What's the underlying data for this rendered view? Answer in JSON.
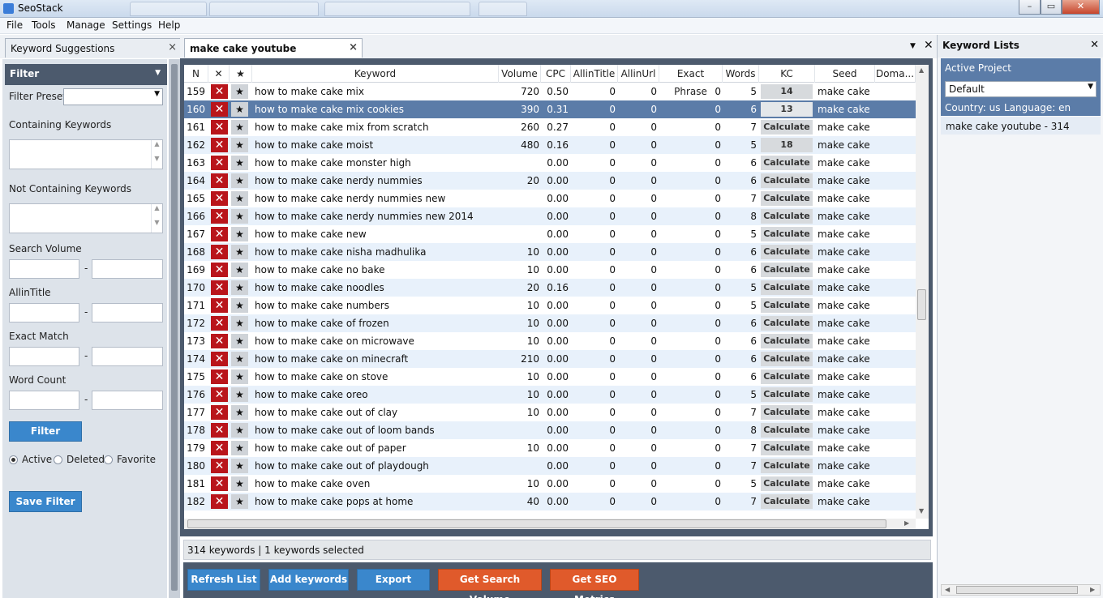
{
  "window": {
    "title": "SeoStack",
    "controls": {
      "minimize": "–",
      "maximize": "▭",
      "close": "✕"
    }
  },
  "menu": [
    "File",
    "Tools",
    "Manage",
    "Settings",
    "Help"
  ],
  "tabs": {
    "left": {
      "label": "Keyword Suggestions"
    },
    "active": {
      "label": "make cake youtube"
    },
    "close_glyph": "×"
  },
  "filter": {
    "header": "Filter",
    "preset_label": "Filter Preset",
    "containing_label": "Containing Keywords",
    "not_containing_label": "Not Containing Keywords",
    "search_volume_label": "Search Volume",
    "allintitle_label": "AllinTitle",
    "exact_match_label": "Exact Match",
    "word_count_label": "Word Count",
    "range_sep": "-",
    "filter_button": "Filter",
    "radios": [
      {
        "label": "Active",
        "checked": true
      },
      {
        "label": "Deleted",
        "checked": false
      },
      {
        "label": "Favorite",
        "checked": false
      }
    ],
    "save_button": "Save Filter"
  },
  "grid": {
    "columns": [
      "N",
      "✕",
      "★",
      "Keyword",
      "Volume",
      "CPC",
      "AllinTitle",
      "AllinUrl",
      "Exact Phrase",
      "Words",
      "KC",
      "Seed",
      "Doma..."
    ],
    "delete_glyph": "✕",
    "star_glyph": "★",
    "rows": [
      {
        "n": "159",
        "keyword": "how to make cake mix",
        "volume": "720",
        "cpc": "0.50",
        "allintitle": "0",
        "allinurl": "0",
        "exact": "0",
        "words": "5",
        "kc": "14",
        "seed": "make cake"
      },
      {
        "n": "160",
        "keyword": "how to make cake mix cookies",
        "volume": "390",
        "cpc": "0.31",
        "allintitle": "0",
        "allinurl": "0",
        "exact": "0",
        "words": "6",
        "kc": "13",
        "seed": "make cake",
        "selected": true
      },
      {
        "n": "161",
        "keyword": "how to make cake mix from scratch",
        "volume": "260",
        "cpc": "0.27",
        "allintitle": "0",
        "allinurl": "0",
        "exact": "0",
        "words": "7",
        "kc": "Calculate",
        "seed": "make cake"
      },
      {
        "n": "162",
        "keyword": "how to make cake moist",
        "volume": "480",
        "cpc": "0.16",
        "allintitle": "0",
        "allinurl": "0",
        "exact": "0",
        "words": "5",
        "kc": "18",
        "seed": "make cake"
      },
      {
        "n": "163",
        "keyword": "how to make cake monster high",
        "volume": "",
        "cpc": "0.00",
        "allintitle": "0",
        "allinurl": "0",
        "exact": "0",
        "words": "6",
        "kc": "Calculate",
        "seed": "make cake"
      },
      {
        "n": "164",
        "keyword": "how to make cake nerdy nummies",
        "volume": "20",
        "cpc": "0.00",
        "allintitle": "0",
        "allinurl": "0",
        "exact": "0",
        "words": "6",
        "kc": "Calculate",
        "seed": "make cake"
      },
      {
        "n": "165",
        "keyword": "how to make cake nerdy nummies new",
        "volume": "",
        "cpc": "0.00",
        "allintitle": "0",
        "allinurl": "0",
        "exact": "0",
        "words": "7",
        "kc": "Calculate",
        "seed": "make cake"
      },
      {
        "n": "166",
        "keyword": "how to make cake nerdy nummies new 2014",
        "volume": "",
        "cpc": "0.00",
        "allintitle": "0",
        "allinurl": "0",
        "exact": "0",
        "words": "8",
        "kc": "Calculate",
        "seed": "make cake"
      },
      {
        "n": "167",
        "keyword": "how to make cake new",
        "volume": "",
        "cpc": "0.00",
        "allintitle": "0",
        "allinurl": "0",
        "exact": "0",
        "words": "5",
        "kc": "Calculate",
        "seed": "make cake"
      },
      {
        "n": "168",
        "keyword": "how to make cake nisha madhulika",
        "volume": "10",
        "cpc": "0.00",
        "allintitle": "0",
        "allinurl": "0",
        "exact": "0",
        "words": "6",
        "kc": "Calculate",
        "seed": "make cake"
      },
      {
        "n": "169",
        "keyword": "how to make cake no bake",
        "volume": "10",
        "cpc": "0.00",
        "allintitle": "0",
        "allinurl": "0",
        "exact": "0",
        "words": "6",
        "kc": "Calculate",
        "seed": "make cake"
      },
      {
        "n": "170",
        "keyword": "how to make cake noodles",
        "volume": "20",
        "cpc": "0.16",
        "allintitle": "0",
        "allinurl": "0",
        "exact": "0",
        "words": "5",
        "kc": "Calculate",
        "seed": "make cake"
      },
      {
        "n": "171",
        "keyword": "how to make cake numbers",
        "volume": "10",
        "cpc": "0.00",
        "allintitle": "0",
        "allinurl": "0",
        "exact": "0",
        "words": "5",
        "kc": "Calculate",
        "seed": "make cake"
      },
      {
        "n": "172",
        "keyword": "how to make cake of frozen",
        "volume": "10",
        "cpc": "0.00",
        "allintitle": "0",
        "allinurl": "0",
        "exact": "0",
        "words": "6",
        "kc": "Calculate",
        "seed": "make cake"
      },
      {
        "n": "173",
        "keyword": "how to make cake on microwave",
        "volume": "10",
        "cpc": "0.00",
        "allintitle": "0",
        "allinurl": "0",
        "exact": "0",
        "words": "6",
        "kc": "Calculate",
        "seed": "make cake"
      },
      {
        "n": "174",
        "keyword": "how to make cake on minecraft",
        "volume": "210",
        "cpc": "0.00",
        "allintitle": "0",
        "allinurl": "0",
        "exact": "0",
        "words": "6",
        "kc": "Calculate",
        "seed": "make cake"
      },
      {
        "n": "175",
        "keyword": "how to make cake on stove",
        "volume": "10",
        "cpc": "0.00",
        "allintitle": "0",
        "allinurl": "0",
        "exact": "0",
        "words": "6",
        "kc": "Calculate",
        "seed": "make cake"
      },
      {
        "n": "176",
        "keyword": "how to make cake oreo",
        "volume": "10",
        "cpc": "0.00",
        "allintitle": "0",
        "allinurl": "0",
        "exact": "0",
        "words": "5",
        "kc": "Calculate",
        "seed": "make cake"
      },
      {
        "n": "177",
        "keyword": "how to make cake out of clay",
        "volume": "10",
        "cpc": "0.00",
        "allintitle": "0",
        "allinurl": "0",
        "exact": "0",
        "words": "7",
        "kc": "Calculate",
        "seed": "make cake"
      },
      {
        "n": "178",
        "keyword": "how to make cake out of loom bands",
        "volume": "",
        "cpc": "0.00",
        "allintitle": "0",
        "allinurl": "0",
        "exact": "0",
        "words": "8",
        "kc": "Calculate",
        "seed": "make cake"
      },
      {
        "n": "179",
        "keyword": "how to make cake out of paper",
        "volume": "10",
        "cpc": "0.00",
        "allintitle": "0",
        "allinurl": "0",
        "exact": "0",
        "words": "7",
        "kc": "Calculate",
        "seed": "make cake"
      },
      {
        "n": "180",
        "keyword": "how to make cake out of playdough",
        "volume": "",
        "cpc": "0.00",
        "allintitle": "0",
        "allinurl": "0",
        "exact": "0",
        "words": "7",
        "kc": "Calculate",
        "seed": "make cake"
      },
      {
        "n": "181",
        "keyword": "how to make cake oven",
        "volume": "10",
        "cpc": "0.00",
        "allintitle": "0",
        "allinurl": "0",
        "exact": "0",
        "words": "5",
        "kc": "Calculate",
        "seed": "make cake"
      },
      {
        "n": "182",
        "keyword": "how to make cake pops at home",
        "volume": "40",
        "cpc": "0.00",
        "allintitle": "0",
        "allinurl": "0",
        "exact": "0",
        "words": "7",
        "kc": "Calculate",
        "seed": "make cake"
      }
    ]
  },
  "status": "314 keywords | 1 keywords selected",
  "actions": {
    "refresh": "Refresh List",
    "add": "Add keywords",
    "export": "Export",
    "search_volume": "Get Search Volume",
    "seo_metrics": "Get SEO Metrics"
  },
  "keyword_lists": {
    "header": "Keyword Lists",
    "active_project_label": "Active Project",
    "project": "Default",
    "country_label": "Country: us",
    "language_label": "Language: en",
    "lists": [
      "make cake youtube - 314"
    ]
  },
  "colors": {
    "selected_row": "#5b7ca8",
    "delete_button": "#b9151b",
    "action_blue": "#3a87cc",
    "action_orange": "#e05a2b",
    "panel_dark": "#4c5a6d"
  }
}
